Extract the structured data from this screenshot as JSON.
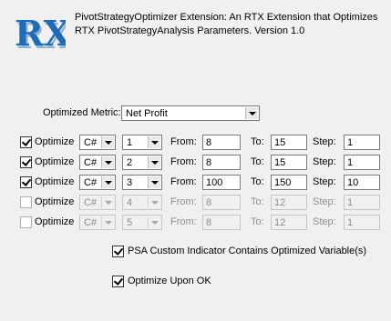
{
  "header": {
    "line1": "PivotStrategyOptimizer Extension: An RTX Extension that Optimizes",
    "line2": "RTX PivotStrategyAnalysis Parameters. Version 1.0",
    "logo_text": "RX"
  },
  "metric": {
    "label": "Optimized Metric:",
    "value": "Net Profit"
  },
  "rows": [
    {
      "optimize_label": "Optimize",
      "checked": true,
      "enabled": true,
      "lang": "C#",
      "index": "1",
      "from_label": "From:",
      "from": "8",
      "to_label": "To:",
      "to": "15",
      "step_label": "Step:",
      "step": "1"
    },
    {
      "optimize_label": "Optimize",
      "checked": true,
      "enabled": true,
      "lang": "C#",
      "index": "2",
      "from_label": "From:",
      "from": "8",
      "to_label": "To:",
      "to": "15",
      "step_label": "Step:",
      "step": "1"
    },
    {
      "optimize_label": "Optimize",
      "checked": true,
      "enabled": true,
      "lang": "C#",
      "index": "3",
      "from_label": "From:",
      "from": "100",
      "to_label": "To:",
      "to": "150",
      "step_label": "Step:",
      "step": "10"
    },
    {
      "optimize_label": "Optimize",
      "checked": false,
      "enabled": false,
      "lang": "C#",
      "index": "4",
      "from_label": "From:",
      "from": "8",
      "to_label": "To:",
      "to": "12",
      "step_label": "Step:",
      "step": "1"
    },
    {
      "optimize_label": "Optimize",
      "checked": false,
      "enabled": false,
      "lang": "C#",
      "index": "5",
      "from_label": "From:",
      "from": "8",
      "to_label": "To:",
      "to": "12",
      "step_label": "Step:",
      "step": "1"
    }
  ],
  "options": {
    "psa_custom": {
      "label": "PSA Custom Indicator Contains Optimized Variable(s)",
      "checked": true
    },
    "optimize_upon_ok": {
      "label": "Optimize Upon OK",
      "checked": true
    }
  },
  "colors": {
    "logo_blue": "#1e6bb8",
    "logo_shadow": "#8fb3d9"
  }
}
